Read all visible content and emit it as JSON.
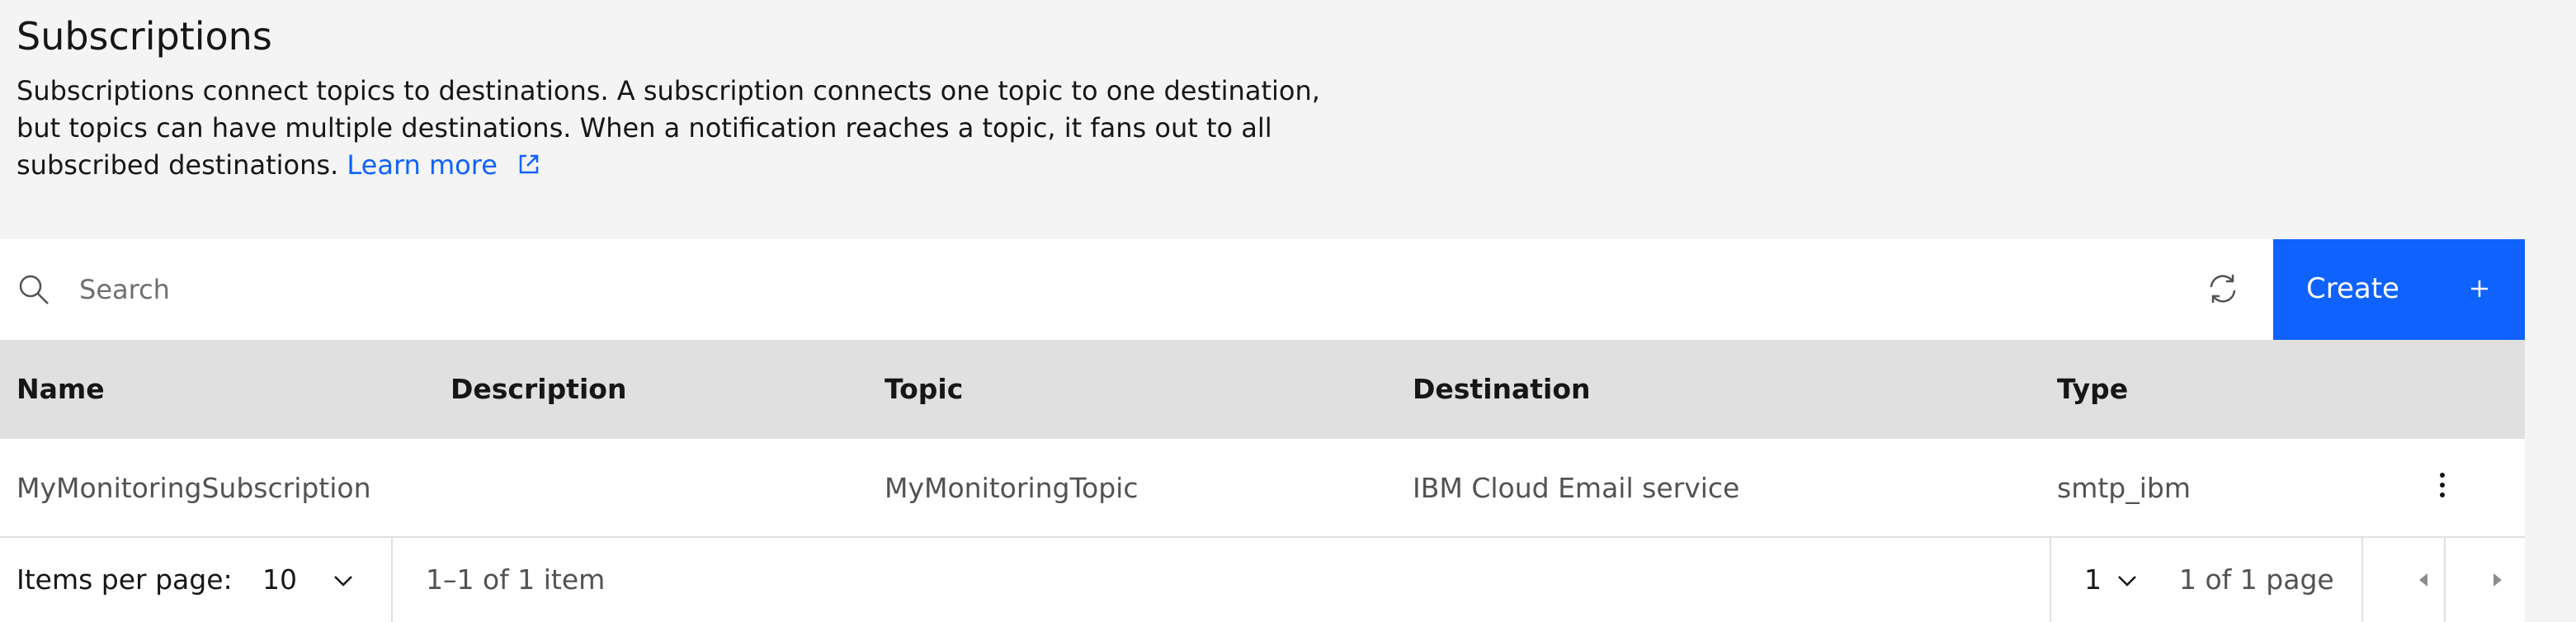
{
  "header": {
    "title": "Subscriptions",
    "description_line1": "Subscriptions connect topics to destinations. A subscription connects one topic to one destination,",
    "description_line2": "but topics can have multiple destinations. When a notification reaches a topic, it fans out to all",
    "description_line3": "subscribed destinations.",
    "learn_more": "Learn more"
  },
  "toolbar": {
    "search_placeholder": "Search",
    "create_label": "Create"
  },
  "table": {
    "columns": [
      "Name",
      "Description",
      "Topic",
      "Destination",
      "Type"
    ],
    "rows": [
      {
        "name": "MyMonitoringSubscription",
        "description": "",
        "topic": "MyMonitoringTopic",
        "destination": "IBM Cloud Email service",
        "type": "smtp_ibm"
      }
    ]
  },
  "pagination": {
    "items_per_page_label": "Items per page:",
    "items_per_page_value": "10",
    "item_range": "1–1 of 1 item",
    "page_value": "1",
    "page_range": "1 of 1 page"
  },
  "colors": {
    "accent": "#0f62fe",
    "page_bg": "#f4f4f4",
    "header_row_bg": "#e0e0e0"
  }
}
